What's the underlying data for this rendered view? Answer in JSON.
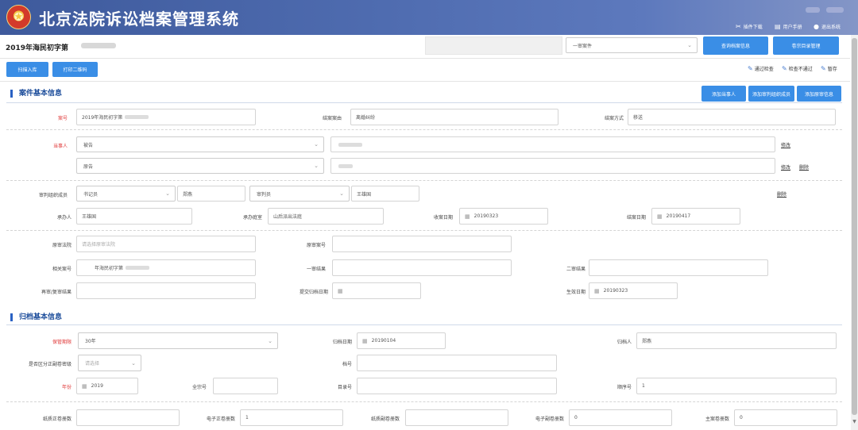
{
  "header": {
    "title": "北京法院诉讼档案管理系统",
    "links": [
      "插件下载",
      "用户手册",
      "退出系统"
    ]
  },
  "case": {
    "title": "2019年海民初字第",
    "type_select": "一审案件",
    "btn_cover": "查询档案信息",
    "btn_catalog": "卷宗目录管理"
  },
  "toolbar": {
    "btn_scan": "扫描入库",
    "btn_print": "打印二维码",
    "link_pass": "通过检查",
    "link_fail": "检查不通过",
    "link_save": "暂存"
  },
  "basic": {
    "title": "案件基本信息",
    "btn_add_party": "添加当事人",
    "btn_add_judge": "添加审判组织成员",
    "btn_add_original": "添加原审信息",
    "case_no_label": "案号",
    "case_no_value": "2019年海民初字第",
    "cause_label": "结案案由",
    "cause_value": "离婚纠纷",
    "method_label": "结案方式",
    "method_value": "移送",
    "party_label": "当事人",
    "party1_role": "被告",
    "party2_role": "原告",
    "party_edit": "修改",
    "party_delete": "删除",
    "judge_label": "审判组织成员",
    "judge_role1": "书记员",
    "judge_name1": "郑燕",
    "judge_role2": "审判员",
    "judge_name2": "王雄国",
    "judge_delete": "删除",
    "handler_label": "承办人",
    "handler_value": "王雄国",
    "court_label": "承办庭室",
    "court_value": "山后派出法庭",
    "filing_date_label": "收案日期",
    "filing_date_value": "20190323",
    "close_date_label": "结案日期",
    "close_date_value": "20190417"
  },
  "original": {
    "court_label": "原审法院",
    "court_placeholder": "请选择原审法院",
    "case_no_label": "原审案号",
    "related_label": "相关案号",
    "related_value": "年海民初字第",
    "first_result_label": "一审结果",
    "second_result_label": "二审结果",
    "retrial_label": "再审/复审结果",
    "submit_date_label": "提交归档日期",
    "effective_date_label": "生效日期",
    "effective_date_value": "20190323"
  },
  "archive": {
    "title": "归档基本信息",
    "period_label": "保管期限",
    "period_value": "30年",
    "archive_date_label": "归档日期",
    "archive_date_value": "20190104",
    "archivist_label": "归档人",
    "archivist_value": "郑燕",
    "secret_label": "是否区分正副卷密级",
    "secret_placeholder": "请选择",
    "file_no_label": "档号",
    "year_label": "年份",
    "year_value": "2019",
    "fonds_label": "全宗号",
    "catalog_label": "目录号",
    "order_label": "顺序号",
    "order_value": "1",
    "paper_main_label": "纸质正卷册数",
    "e_main_label": "电子正卷册数",
    "e_main_value": "1",
    "paper_sub_label": "纸质副卷册数",
    "e_sub_label": "电子副卷册数",
    "e_sub_value": "0",
    "bound_label": "主案卷册数",
    "bound_value": "0"
  }
}
